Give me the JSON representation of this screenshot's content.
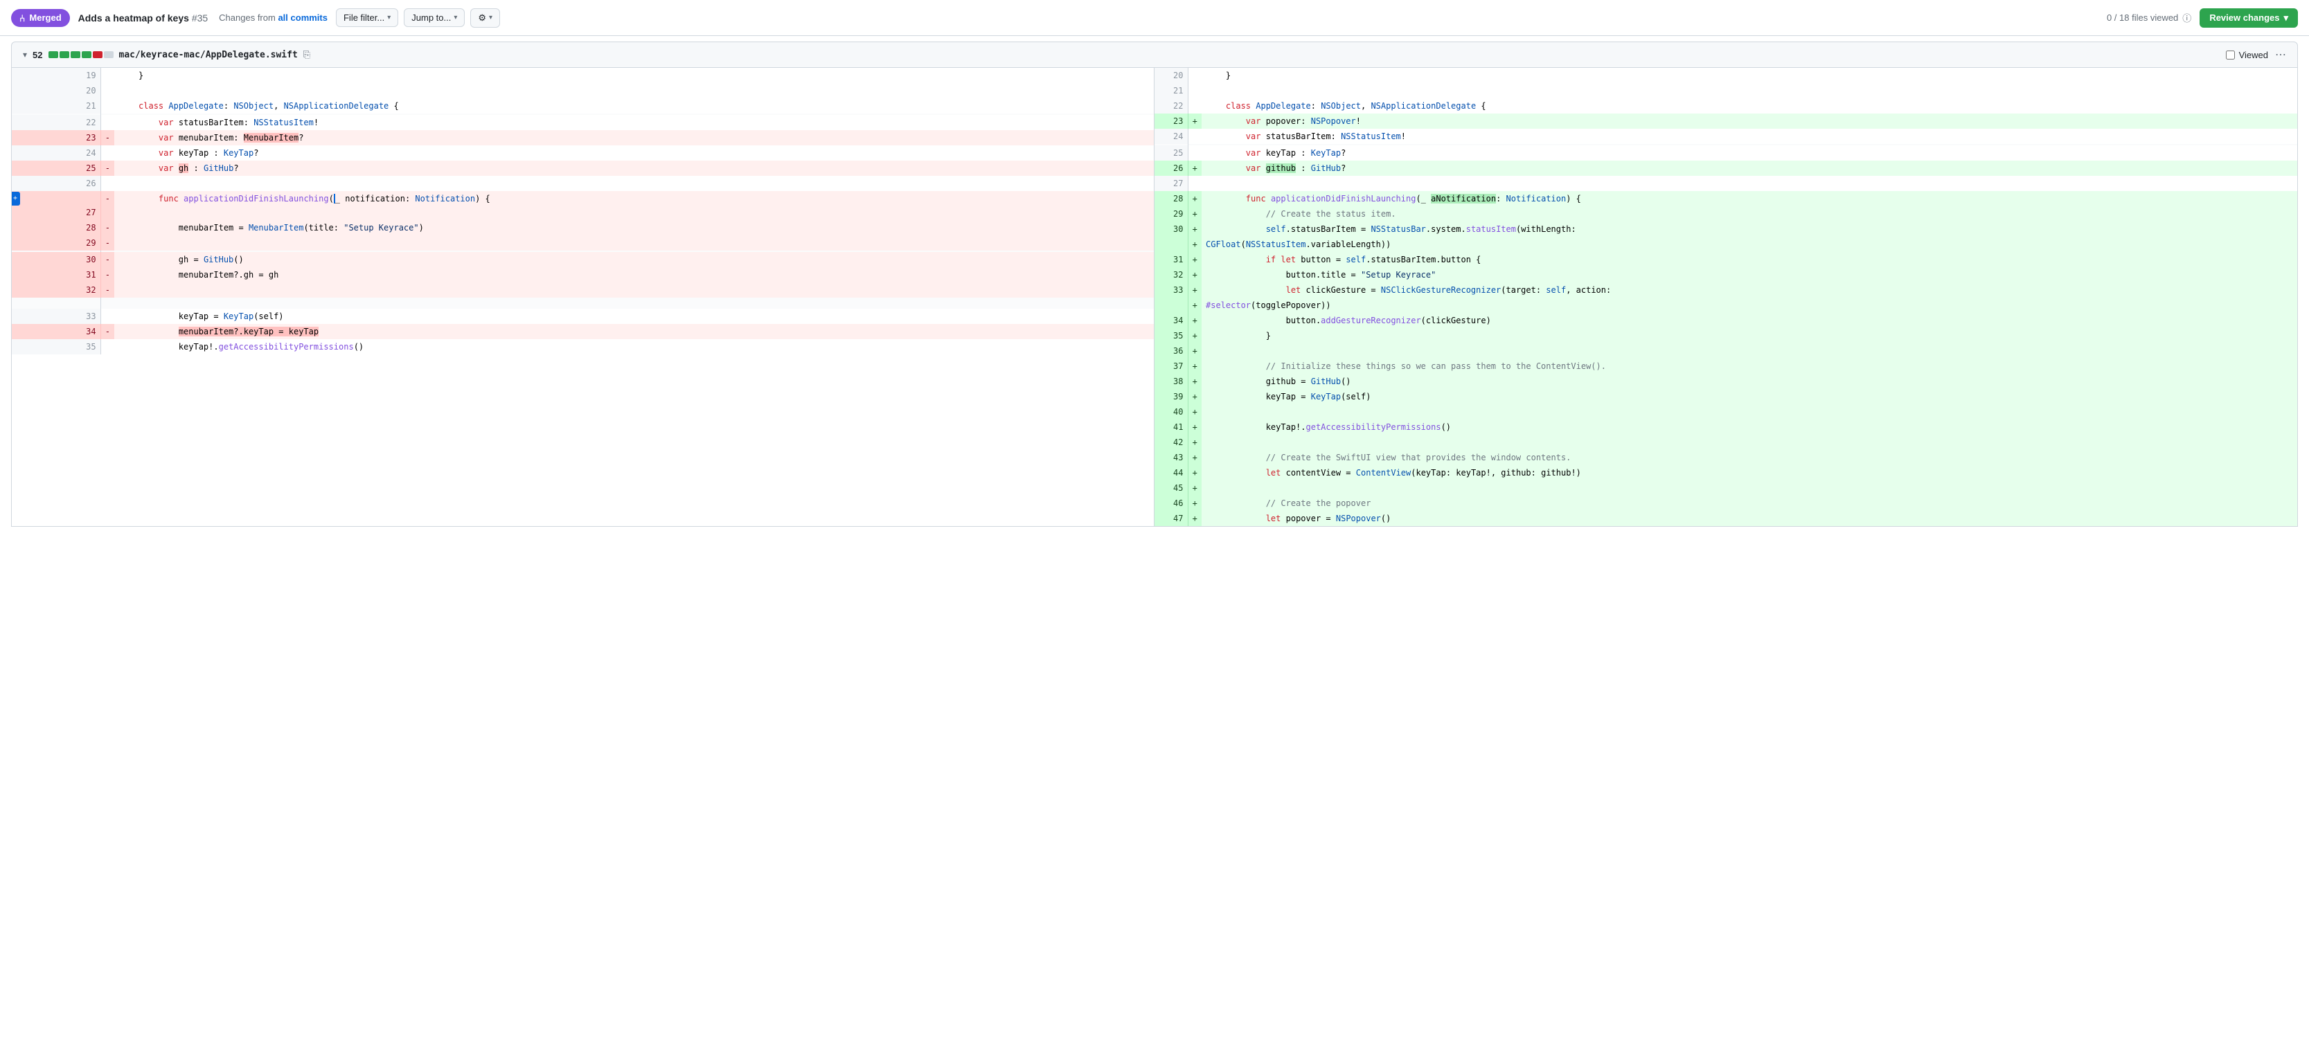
{
  "topbar": {
    "merged_label": "Merged",
    "pr_title": "Adds a heatmap of keys",
    "pr_number": "#35",
    "changes_label": "Changes from",
    "all_commits_link": "all commits",
    "file_filter_label": "File filter...",
    "jump_to_label": "Jump to...",
    "settings_label": "⚙",
    "files_viewed": "0 / 18 files viewed",
    "review_changes_label": "Review changes"
  },
  "file_header": {
    "line_count": "52",
    "diff_bars": [
      {
        "type": "green"
      },
      {
        "type": "green"
      },
      {
        "type": "green"
      },
      {
        "type": "green"
      },
      {
        "type": "red"
      },
      {
        "type": "gray"
      }
    ],
    "file_path": "mac/keyrace-mac/AppDelegate.swift",
    "viewed_label": "Viewed"
  },
  "diff": {
    "left_lines": [
      {
        "old_num": "19",
        "sign": "",
        "code": "    }",
        "type": "neutral"
      },
      {
        "old_num": "20",
        "sign": "",
        "code": "",
        "type": "neutral"
      },
      {
        "old_num": "21",
        "sign": "",
        "code": "    class AppDelegate: NSObject, NSApplicationDelegate {",
        "type": "neutral"
      },
      {
        "old_num": "",
        "sign": "",
        "code": "",
        "type": "neutral"
      },
      {
        "old_num": "22",
        "sign": "",
        "code": "        var statusBarItem: NSStatusItem!",
        "type": "neutral"
      },
      {
        "old_num": "23",
        "sign": "-",
        "code": "        var menubarItem: MenubarItem?",
        "type": "deleted"
      },
      {
        "old_num": "24",
        "sign": "",
        "code": "        var keyTap : KeyTap?",
        "type": "neutral"
      },
      {
        "old_num": "25",
        "sign": "-",
        "code": "        var gh : GitHub?",
        "type": "deleted"
      },
      {
        "old_num": "26",
        "sign": "",
        "code": "",
        "type": "neutral"
      },
      {
        "old_num": "27",
        "sign": "-",
        "code": "        func applicationDidFinishLaunching(_ notification: Notification) {",
        "type": "deleted_cursor"
      },
      {
        "old_num": "28",
        "sign": "-",
        "code": "            menubarItem = MenubarItem(title: \"Setup Keyrace\")",
        "type": "deleted"
      },
      {
        "old_num": "29",
        "sign": "-",
        "code": "",
        "type": "deleted"
      },
      {
        "old_num": "",
        "sign": "",
        "code": "",
        "type": "neutral"
      },
      {
        "old_num": "30",
        "sign": "-",
        "code": "            gh = GitHub()",
        "type": "deleted"
      },
      {
        "old_num": "31",
        "sign": "-",
        "code": "            menubarItem?.gh = gh",
        "type": "deleted"
      },
      {
        "old_num": "32",
        "sign": "-",
        "code": "",
        "type": "deleted"
      },
      {
        "old_num": "",
        "sign": "",
        "code": "",
        "type": "neutral"
      },
      {
        "old_num": "",
        "sign": "",
        "code": "",
        "type": "neutral"
      },
      {
        "old_num": "",
        "sign": "",
        "code": "",
        "type": "neutral"
      },
      {
        "old_num": "",
        "sign": "",
        "code": "",
        "type": "neutral"
      },
      {
        "old_num": "",
        "sign": "",
        "code": "",
        "type": "neutral"
      },
      {
        "old_num": "",
        "sign": "",
        "code": "",
        "type": "neutral"
      },
      {
        "old_num": "",
        "sign": "",
        "code": "",
        "type": "neutral"
      },
      {
        "old_num": "",
        "sign": "",
        "code": "",
        "type": "neutral"
      },
      {
        "old_num": "",
        "sign": "",
        "code": "",
        "type": "neutral"
      },
      {
        "old_num": "",
        "sign": "",
        "code": "",
        "type": "neutral"
      },
      {
        "old_num": "",
        "sign": "",
        "code": "",
        "type": "neutral"
      },
      {
        "old_num": "33",
        "sign": "",
        "code": "            keyTap = KeyTap(self)",
        "type": "neutral"
      },
      {
        "old_num": "34",
        "sign": "-",
        "code": "            menubarItem?.keyTap = keyTap",
        "type": "deleted"
      },
      {
        "old_num": "35",
        "sign": "",
        "code": "            keyTap!.getAccessibilityPermissions()",
        "type": "neutral"
      }
    ],
    "right_lines": [
      {
        "new_num": "20",
        "sign": "",
        "code": "    }",
        "type": "neutral"
      },
      {
        "new_num": "21",
        "sign": "",
        "code": "",
        "type": "neutral"
      },
      {
        "new_num": "22",
        "sign": "",
        "code": "    class AppDelegate: NSObject, NSApplicationDelegate {",
        "type": "neutral"
      },
      {
        "new_num": "23",
        "sign": "+",
        "code": "        var popover: NSPopover!",
        "type": "added"
      },
      {
        "new_num": "24",
        "sign": "",
        "code": "        var statusBarItem: NSStatusItem!",
        "type": "neutral"
      },
      {
        "new_num": "",
        "sign": "",
        "code": "",
        "type": "neutral"
      },
      {
        "new_num": "25",
        "sign": "",
        "code": "        var keyTap : KeyTap?",
        "type": "neutral"
      },
      {
        "new_num": "26",
        "sign": "+",
        "code": "        var github : GitHub?",
        "type": "added"
      },
      {
        "new_num": "27",
        "sign": "",
        "code": "",
        "type": "neutral"
      },
      {
        "new_num": "28",
        "sign": "+",
        "code": "        func applicationDidFinishLaunching(_ aNotification: Notification) {",
        "type": "added"
      },
      {
        "new_num": "29",
        "sign": "+",
        "code": "            // Create the status item.",
        "type": "added"
      },
      {
        "new_num": "30",
        "sign": "+",
        "code": "            self.statusBarItem = NSStatusBar.system.statusItem(withLength:",
        "type": "added"
      },
      {
        "new_num": "",
        "sign": "+",
        "code": "CGFloat(NSStatusItem.variableLength))",
        "type": "added"
      },
      {
        "new_num": "31",
        "sign": "+",
        "code": "            if let button = self.statusBarItem.button {",
        "type": "added"
      },
      {
        "new_num": "32",
        "sign": "+",
        "code": "                button.title = \"Setup Keyrace\"",
        "type": "added"
      },
      {
        "new_num": "33",
        "sign": "+",
        "code": "                let clickGesture = NSClickGestureRecognizer(target: self, action:",
        "type": "added"
      },
      {
        "new_num": "",
        "sign": "+",
        "code": "#selector(togglePopover))",
        "type": "added"
      },
      {
        "new_num": "34",
        "sign": "+",
        "code": "                button.addGestureRecognizer(clickGesture)",
        "type": "added"
      },
      {
        "new_num": "35",
        "sign": "+",
        "code": "            }",
        "type": "added"
      },
      {
        "new_num": "36",
        "sign": "+",
        "code": "",
        "type": "added"
      },
      {
        "new_num": "37",
        "sign": "+",
        "code": "            // Initialize these things so we can pass them to the ContentView().",
        "type": "added"
      },
      {
        "new_num": "38",
        "sign": "+",
        "code": "            github = GitHub()",
        "type": "added"
      },
      {
        "new_num": "39",
        "sign": "+",
        "code": "            keyTap = KeyTap(self)",
        "type": "added"
      },
      {
        "new_num": "40",
        "sign": "+",
        "code": "",
        "type": "added"
      },
      {
        "new_num": "41",
        "sign": "+",
        "code": "            keyTap!.getAccessibilityPermissions()",
        "type": "added"
      },
      {
        "new_num": "42",
        "sign": "+",
        "code": "",
        "type": "added"
      },
      {
        "new_num": "43",
        "sign": "+",
        "code": "            // Create the SwiftUI view that provides the window contents.",
        "type": "added"
      },
      {
        "new_num": "44",
        "sign": "+",
        "code": "            let contentView = ContentView(keyTap: keyTap!, github: github!)",
        "type": "added"
      },
      {
        "new_num": "45",
        "sign": "+",
        "code": "",
        "type": "added"
      },
      {
        "new_num": "46",
        "sign": "+",
        "code": "            // Create the popover",
        "type": "added"
      },
      {
        "new_num": "47",
        "sign": "+",
        "code": "            let popover = NSPopover()",
        "type": "added"
      }
    ]
  },
  "colors": {
    "merged_bg": "#8250df",
    "added_bg": "#e6ffec",
    "added_line_bg": "#ccffd8",
    "deleted_bg": "#fff0ef",
    "deleted_line_bg": "#ffd7d5",
    "review_btn_bg": "#2da44e"
  }
}
